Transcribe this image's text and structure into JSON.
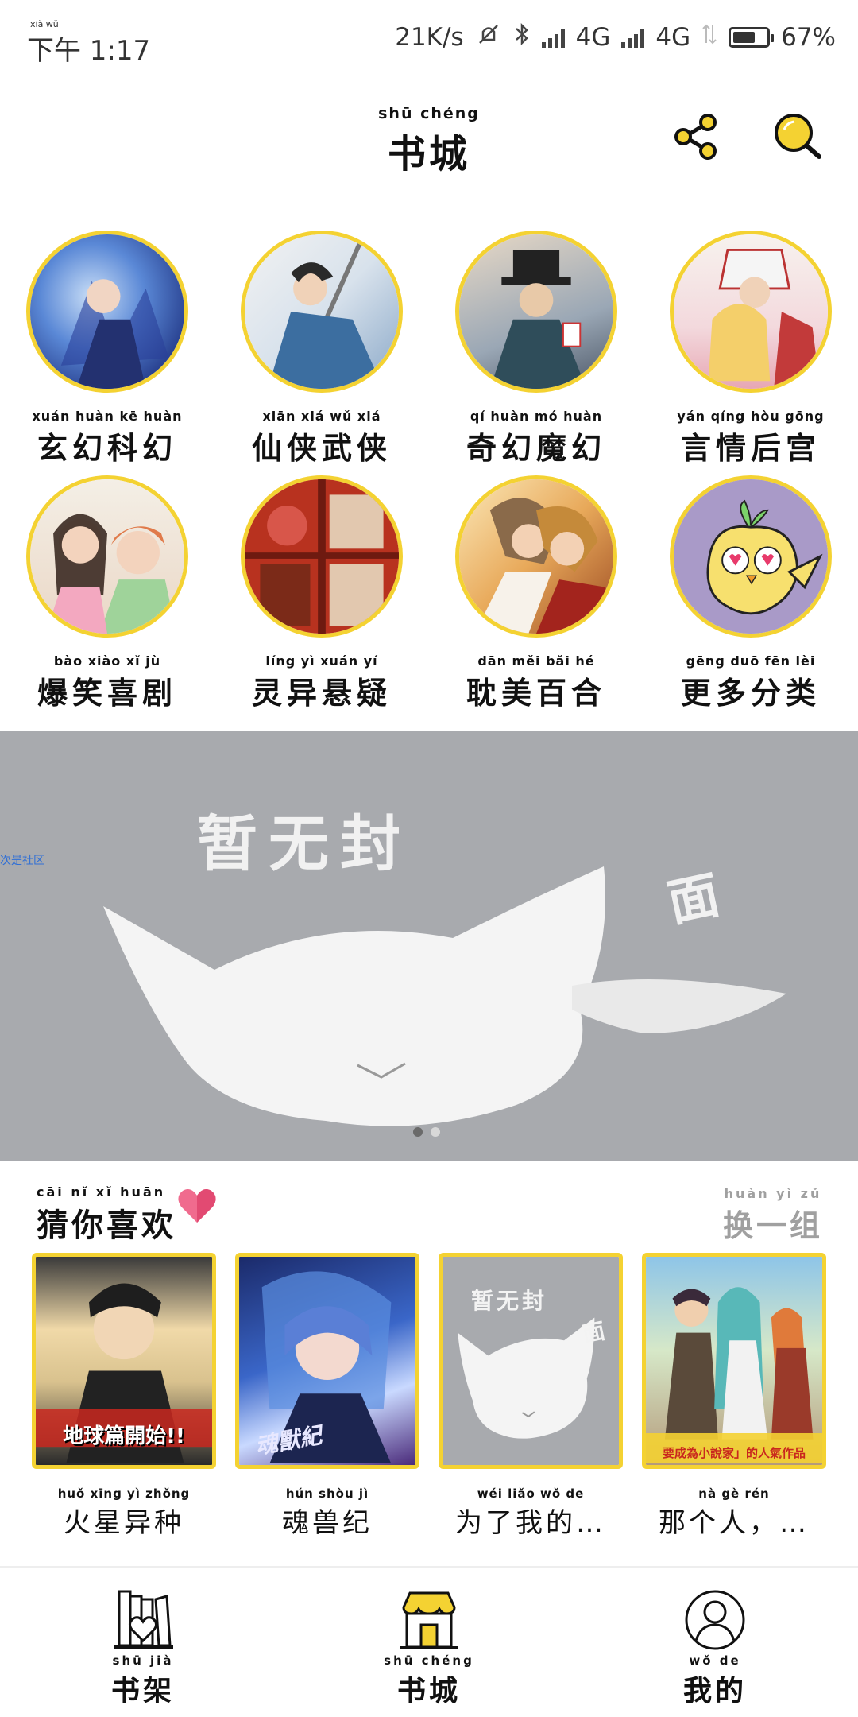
{
  "status_bar": {
    "time_pinyin": "xià wǔ",
    "time": "下午 1:17",
    "speed": "21K/s",
    "network1": "4G",
    "network2": "4G",
    "battery_pct": "67%",
    "battery_level": 0.67
  },
  "header": {
    "title_pinyin": "shū  chéng",
    "title": "书城"
  },
  "categories": [
    {
      "pinyin": "xuán huàn kē huàn",
      "label": "玄幻科幻"
    },
    {
      "pinyin": "xiān xiá wǔ xiá",
      "label": "仙侠武侠"
    },
    {
      "pinyin": "qí huàn mó huàn",
      "label": "奇幻魔幻"
    },
    {
      "pinyin": "yán qíng hòu gōng",
      "label": "言情后宫"
    },
    {
      "pinyin": "bào xiào xǐ jù",
      "label": "爆笑喜剧"
    },
    {
      "pinyin": "líng yì xuán yí",
      "label": "灵异悬疑"
    },
    {
      "pinyin": "dān měi bǎi hé",
      "label": "耽美百合"
    },
    {
      "pinyin": "gēng duō fēn lèi",
      "label": "更多分类"
    }
  ],
  "banner": {
    "text_main": "暂无封",
    "text_side": "面",
    "tag": "次是社区"
  },
  "recommend": {
    "title_pinyin": "cāi nǐ xǐ huān",
    "title": "猜你喜欢",
    "refresh_pinyin": "huàn yì zǔ",
    "refresh": "换一组",
    "books": [
      {
        "pinyin": "huǒ xīng yì zhǒng",
        "title": "火星异种",
        "cover_text": "地球篇開始!!"
      },
      {
        "pinyin": "hún shòu jì",
        "title": "魂兽纪",
        "cover_text": "魂獸紀"
      },
      {
        "pinyin": "wéi liǎo wǒ de",
        "title": "为了我的…",
        "cover_text": "暂无封",
        "cover_text2": "面"
      },
      {
        "pinyin": "nà gè rén",
        "title": "那个人，…",
        "cover_text": "要成為小說家」的人氣作品"
      }
    ]
  },
  "bottom_nav": [
    {
      "pinyin": "shū jià",
      "label": "书架"
    },
    {
      "pinyin": "shū chéng",
      "label": "书城"
    },
    {
      "pinyin": "wǒ de",
      "label": "我的"
    }
  ]
}
